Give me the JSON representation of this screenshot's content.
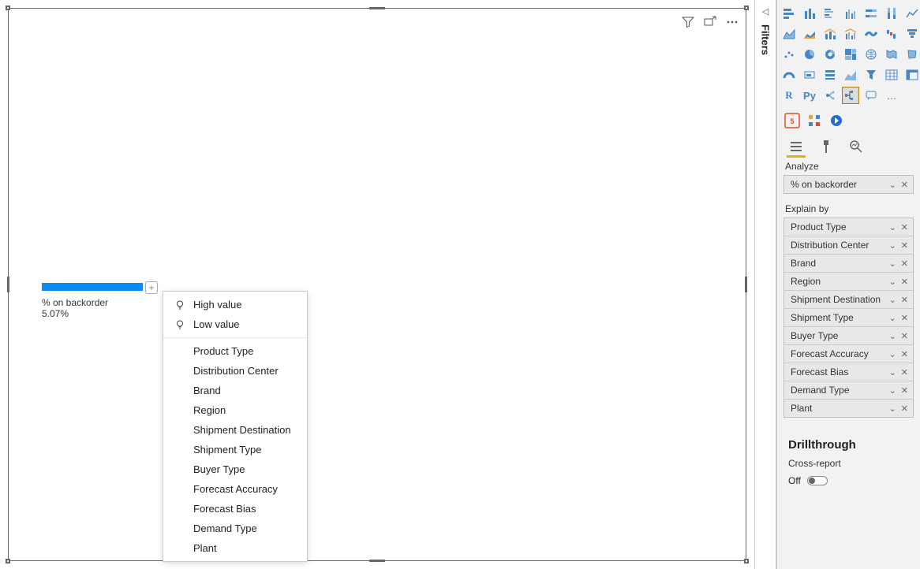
{
  "filtersRailLabel": "Filters",
  "visual": {
    "metricLabel": "% on backorder",
    "metricValue": "5.07%"
  },
  "contextMenu": {
    "high": "High value",
    "low": "Low value",
    "fields": [
      "Product Type",
      "Distribution Center",
      "Brand",
      "Region",
      "Shipment Destination",
      "Shipment Type",
      "Buyer Type",
      "Forecast Accuracy",
      "Forecast Bias",
      "Demand Type",
      "Plant"
    ]
  },
  "analyze": {
    "label": "Analyze",
    "well": [
      "% on backorder"
    ]
  },
  "explain": {
    "label": "Explain by",
    "well": [
      "Product Type",
      "Distribution Center",
      "Brand",
      "Region",
      "Shipment Destination",
      "Shipment Type",
      "Buyer Type",
      "Forecast Accuracy",
      "Forecast Bias",
      "Demand Type",
      "Plant"
    ]
  },
  "drill": {
    "heading": "Drillthrough",
    "crossReport": "Cross-report",
    "toggleState": "Off"
  },
  "vizIconsLetters": {
    "r": "R",
    "py": "Py",
    "more": "…"
  }
}
